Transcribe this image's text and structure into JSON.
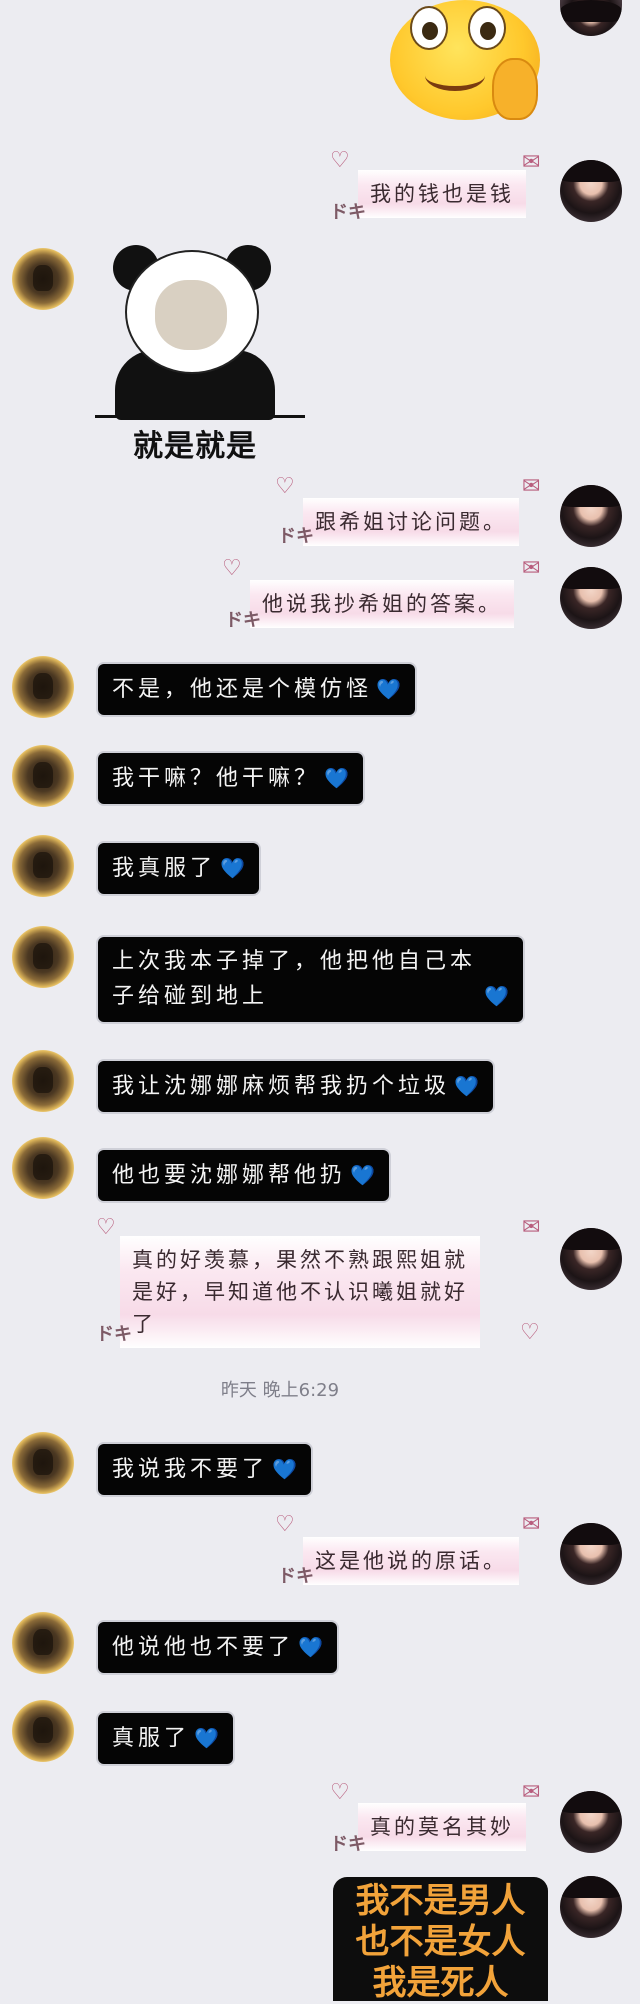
{
  "timestamp": "昨天 晚上6:29",
  "panda_sticker": {
    "caption": "就是就是"
  },
  "final_sticker": {
    "lines": [
      "我不是男人",
      "也不是女人",
      "我是死人"
    ]
  },
  "decorations": {
    "kanji": "ドキ",
    "heart": "💙"
  },
  "messages": [
    {
      "side": "me",
      "style": "pink",
      "text": "我的钱也是钱"
    },
    {
      "side": "me",
      "style": "pink",
      "text": "跟希姐讨论问题。"
    },
    {
      "side": "me",
      "style": "pink",
      "text": "他说我抄希姐的答案。"
    },
    {
      "side": "other",
      "style": "dark",
      "text": "不是，他还是个模仿怪"
    },
    {
      "side": "other",
      "style": "dark",
      "text": "我干嘛？他干嘛？"
    },
    {
      "side": "other",
      "style": "dark",
      "text": "我真服了"
    },
    {
      "side": "other",
      "style": "dark",
      "line1": "上次我本子掉了，他把他自己本",
      "line2": "子给碰到地上"
    },
    {
      "side": "other",
      "style": "dark",
      "text": "我让沈娜娜麻烦帮我扔个垃圾"
    },
    {
      "side": "other",
      "style": "dark",
      "text": "他也要沈娜娜帮他扔"
    },
    {
      "side": "me",
      "style": "pink",
      "line1": "真的好羡慕，果然不熟跟熙姐就",
      "line2": "是好，早知道他不认识曦姐就好",
      "line3": "了"
    },
    {
      "side": "other",
      "style": "dark",
      "text": "我说我不要了"
    },
    {
      "side": "me",
      "style": "pink",
      "text": "这是他说的原话。"
    },
    {
      "side": "other",
      "style": "dark",
      "text": "他说他也不要了"
    },
    {
      "side": "other",
      "style": "dark",
      "text": "真服了"
    },
    {
      "side": "me",
      "style": "pink",
      "text": "真的莫名其妙"
    }
  ]
}
